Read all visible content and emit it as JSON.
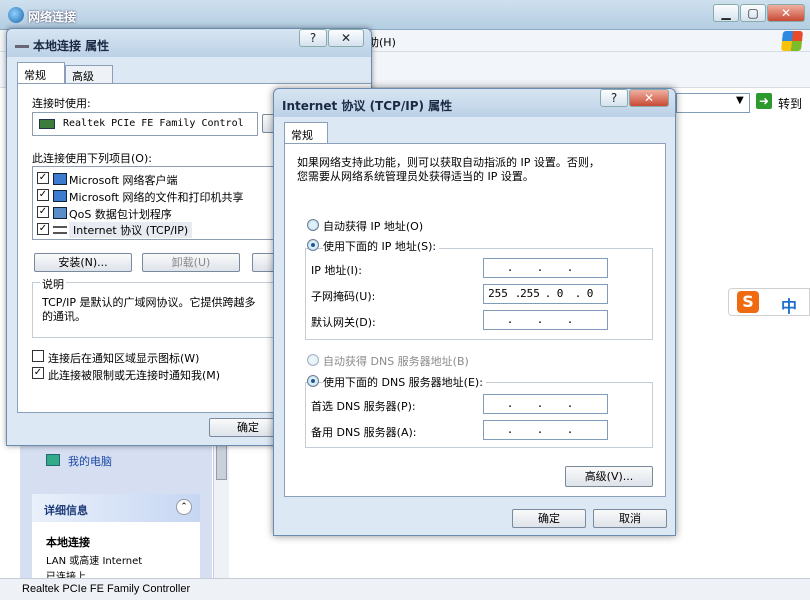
{
  "main_window": {
    "title": "网络连接",
    "menu_fragment": "助(H)",
    "address_go": "转到",
    "statusbar": "Realtek PCIe FE Family Controller"
  },
  "side": {
    "my_computer": "我的电脑",
    "detail_title": "详细信息",
    "local_conn": "本地连接",
    "lan_desc": "LAN 或高速 Internet",
    "more_text": "已连接上"
  },
  "ime": {
    "logo": "S",
    "lang": "中"
  },
  "props": {
    "title": "本地连接 属性",
    "tabs": [
      "常规",
      "高级"
    ],
    "connect_using": "连接时使用:",
    "adapter": "Realtek PCIe FE Family Control",
    "items_label": "此连接使用下列项目(O):",
    "items": [
      "Microsoft 网络客户端",
      "Microsoft 网络的文件和打印机共享",
      "QoS 数据包计划程序",
      "Internet 协议 (TCP/IP)"
    ],
    "install": "安装(N)...",
    "uninstall": "卸载(U)",
    "desc_label": "说明",
    "desc_text1": "TCP/IP 是默认的广域网协议。它提供跨越多",
    "desc_text2": "的通讯。",
    "show_icon": "连接后在通知区域显示图标(W)",
    "notify": "此连接被限制或无连接时通知我(M)",
    "ok": "确定"
  },
  "tcpip": {
    "title": "Internet 协议 (TCP/IP) 属性",
    "tab": "常规",
    "intro1": "如果网络支持此功能，则可以获取自动指派的 IP 设置。否则，",
    "intro2": "您需要从网络系统管理员处获得适当的 IP 设置。",
    "auto_ip": "自动获得 IP 地址(O)",
    "manual_ip": "使用下面的 IP 地址(S):",
    "ip_label": "IP 地址(I):",
    "mask_label": "子网掩码(U):",
    "gw_label": "默认网关(D):",
    "mask": [
      "255",
      "255",
      "0",
      "0"
    ],
    "auto_dns": "自动获得 DNS 服务器地址(B)",
    "manual_dns": "使用下面的 DNS 服务器地址(E):",
    "dns1_label": "首选 DNS 服务器(P):",
    "dns2_label": "备用 DNS 服务器(A):",
    "advanced": "高级(V)...",
    "ok": "确定",
    "cancel": "取消"
  }
}
